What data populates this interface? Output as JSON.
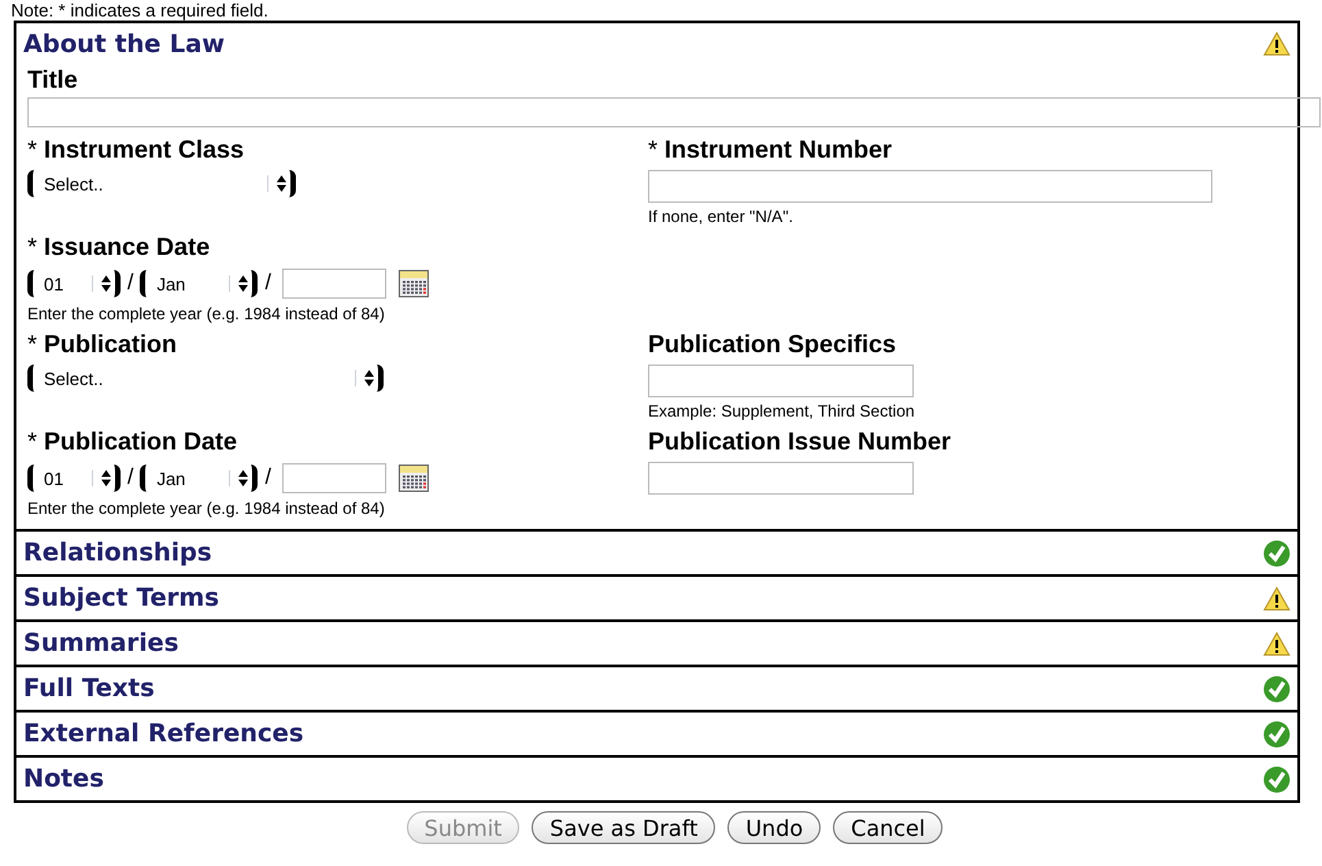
{
  "note": "Note: * indicates a required field.",
  "about": {
    "title": "About the Law",
    "complete": false,
    "title_field": {
      "label": "Title"
    },
    "rows": [
      {
        "left": {
          "kind": "select",
          "label": "* **Instrument Class**",
          "value": "Select..",
          "wide": false
        },
        "right": {
          "kind": "text",
          "label": "* **Instrument Number**",
          "wide": true,
          "hint": "If none, enter \"N/A\"."
        }
      },
      {
        "left": {
          "kind": "date",
          "label": "* **Issuance Date**",
          "day": "01",
          "month": "Jan",
          "separators": [
            "/",
            "/"
          ],
          "hint": "Enter the complete year (e.g. 1984 instead of 84)"
        },
        "right": null
      },
      {
        "left": {
          "kind": "select",
          "label": "* **Publication**",
          "value": "Select..",
          "wide": true
        },
        "right": {
          "kind": "text",
          "label": "**Publication Specifics**",
          "wide": false,
          "hint": "Example: Supplement, Third Section"
        }
      },
      {
        "left": {
          "kind": "date",
          "label": "* **Publication Date**",
          "day": "01",
          "month": "Jan",
          "separators": [
            "/",
            "/"
          ],
          "hint": "Enter the complete year (e.g. 1984 instead of 84)"
        },
        "right": {
          "kind": "text",
          "label": "**Publication Issue Number**",
          "wide": false
        }
      }
    ]
  },
  "sections": [
    {
      "title": "Relationships",
      "complete": true
    },
    {
      "title": "Subject Terms",
      "complete": false
    },
    {
      "title": "Summaries",
      "complete": false
    },
    {
      "title": "Full Texts",
      "complete": true
    },
    {
      "title": "External References",
      "complete": true
    },
    {
      "title": "Notes",
      "complete": true
    }
  ],
  "buttons": [
    {
      "label": "Submit",
      "disabled": true
    },
    {
      "label": "Save as Draft",
      "disabled": false
    },
    {
      "label": "Undo",
      "disabled": false
    },
    {
      "label": "Cancel",
      "disabled": false
    }
  ]
}
